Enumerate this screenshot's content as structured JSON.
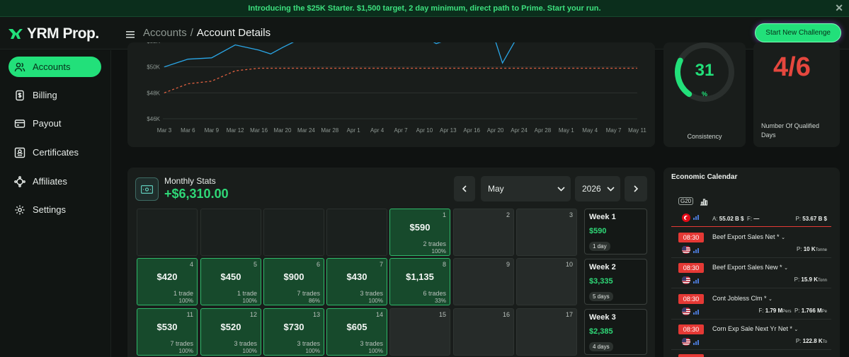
{
  "banner": {
    "text": "Introducing the $25K Starter. $1,500 target, 2 day minimum, direct path to Prime. Start your run."
  },
  "brand": {
    "name": "YRM Prop.",
    "accent": "#22e07a"
  },
  "breadcrumb": {
    "root": "Accounts",
    "separator": "/",
    "current": "Account Details"
  },
  "header": {
    "cta_label": "Start New Challenge"
  },
  "sidebar": {
    "items": [
      {
        "label": "Accounts",
        "icon": "users-icon",
        "active": true
      },
      {
        "label": "Billing",
        "icon": "billing-icon",
        "active": false
      },
      {
        "label": "Payout",
        "icon": "payout-icon",
        "active": false
      },
      {
        "label": "Certificates",
        "icon": "certificate-icon",
        "active": false
      },
      {
        "label": "Affiliates",
        "icon": "affiliates-icon",
        "active": false
      },
      {
        "label": "Settings",
        "icon": "gear-icon",
        "active": false
      }
    ]
  },
  "chart_data": {
    "type": "line",
    "yticks": [
      "$46K",
      "$48K",
      "$50K",
      "$52K"
    ],
    "ylim": [
      46000,
      52000
    ],
    "xticks": [
      "Mar 3",
      "Mar 6",
      "Mar 9",
      "Mar 12",
      "Mar 16",
      "Mar 20",
      "Mar 24",
      "Mar 28",
      "Apr 1",
      "Apr 4",
      "Apr 7",
      "Apr 10",
      "Apr 13",
      "Apr 16",
      "Apr 20",
      "Apr 24",
      "Apr 28",
      "May 1",
      "May 4",
      "May 7",
      "May 11"
    ],
    "grid": true,
    "series": [
      {
        "color": "#2aa7e8",
        "style": "solid",
        "points": [
          [
            0,
            50000
          ],
          [
            1,
            50600
          ],
          [
            2,
            50700
          ],
          [
            3,
            51700
          ],
          [
            4,
            51300
          ],
          [
            4.5,
            51000
          ],
          [
            5,
            51500
          ],
          [
            6,
            52400
          ],
          [
            7,
            52600
          ],
          [
            8,
            52500
          ],
          [
            9,
            52700
          ],
          [
            10,
            52500
          ],
          [
            11,
            52300
          ],
          [
            11.5,
            51800
          ],
          [
            12,
            52100
          ],
          [
            13,
            52600
          ],
          [
            14,
            52000
          ],
          [
            14.3,
            50300
          ],
          [
            14.8,
            51900
          ],
          [
            15,
            52200
          ],
          [
            16,
            52800
          ],
          [
            17,
            52400
          ],
          [
            17.5,
            52000
          ],
          [
            18,
            52600
          ],
          [
            19,
            52800
          ],
          [
            20,
            52700
          ]
        ]
      },
      {
        "color": "#e06040",
        "style": "dashed",
        "points": [
          [
            0,
            48000
          ],
          [
            1,
            48700
          ],
          [
            2,
            48900
          ],
          [
            3,
            49700
          ],
          [
            4,
            49900
          ],
          [
            5,
            49900
          ],
          [
            10,
            49900
          ],
          [
            20,
            49900
          ]
        ]
      }
    ]
  },
  "consistency": {
    "value": "31",
    "unit": "%",
    "label": "Consistency",
    "fraction": 0.31
  },
  "qualified_days": {
    "value": "4/6",
    "label": "Number Of Qualified Days"
  },
  "monthly": {
    "title": "Monthly Stats",
    "total": "+$6,310.00",
    "month": "May",
    "year": "2026",
    "weeks": [
      {
        "label": "Week 1",
        "amount": "$590",
        "days": "1 day"
      },
      {
        "label": "Week 2",
        "amount": "$3,335",
        "days": "5 days"
      },
      {
        "label": "Week 3",
        "amount": "$2,385",
        "days": "4 days"
      }
    ],
    "days": [
      {
        "num": "",
        "amount": "",
        "trades": "",
        "pct": "",
        "kind": "empty"
      },
      {
        "num": "",
        "amount": "",
        "trades": "",
        "pct": "",
        "kind": "empty"
      },
      {
        "num": "",
        "amount": "",
        "trades": "",
        "pct": "",
        "kind": "empty"
      },
      {
        "num": "",
        "amount": "",
        "trades": "",
        "pct": "",
        "kind": "empty"
      },
      {
        "num": "1",
        "amount": "$590",
        "trades": "2 trades",
        "pct": "100%",
        "kind": "profit"
      },
      {
        "num": "2",
        "amount": "",
        "trades": "",
        "pct": "",
        "kind": "future"
      },
      {
        "num": "3",
        "amount": "",
        "trades": "",
        "pct": "",
        "kind": "future"
      },
      {
        "num": "4",
        "amount": "$420",
        "trades": "1 trade",
        "pct": "100%",
        "kind": "profit"
      },
      {
        "num": "5",
        "amount": "$450",
        "trades": "1 trade",
        "pct": "100%",
        "kind": "profit"
      },
      {
        "num": "6",
        "amount": "$900",
        "trades": "7 trades",
        "pct": "86%",
        "kind": "profit"
      },
      {
        "num": "7",
        "amount": "$430",
        "trades": "3 trades",
        "pct": "100%",
        "kind": "profit"
      },
      {
        "num": "8",
        "amount": "$1,135",
        "trades": "6 trades",
        "pct": "33%",
        "kind": "profit"
      },
      {
        "num": "9",
        "amount": "",
        "trades": "",
        "pct": "",
        "kind": "future"
      },
      {
        "num": "10",
        "amount": "",
        "trades": "",
        "pct": "",
        "kind": "future"
      },
      {
        "num": "11",
        "amount": "$530",
        "trades": "7 trades",
        "pct": "100%",
        "kind": "profit"
      },
      {
        "num": "12",
        "amount": "$520",
        "trades": "3 trades",
        "pct": "100%",
        "kind": "profit"
      },
      {
        "num": "13",
        "amount": "$730",
        "trades": "3 trades",
        "pct": "100%",
        "kind": "profit"
      },
      {
        "num": "14",
        "amount": "$605",
        "trades": "3 trades",
        "pct": "100%",
        "kind": "profit"
      },
      {
        "num": "15",
        "amount": "",
        "trades": "",
        "pct": "",
        "kind": "future"
      },
      {
        "num": "16",
        "amount": "",
        "trades": "",
        "pct": "",
        "kind": "future"
      },
      {
        "num": "17",
        "amount": "",
        "trades": "",
        "pct": "",
        "kind": "future"
      }
    ]
  },
  "economic_calendar": {
    "title": "Economic Calendar",
    "top_row": {
      "a": "A:",
      "a_val": "55.02 B $",
      "f": "F:",
      "f_val": "—",
      "p": "P:",
      "p_val": "53.67 B $"
    },
    "rows": [
      {
        "time": "08:30",
        "name": "Beef Export Sales Net *",
        "values": [
          {
            "k": "P:",
            "v": "10 K",
            "u": "Tonne"
          }
        ]
      },
      {
        "time": "08:30",
        "name": "Beef Export Sales New *",
        "values": [
          {
            "k": "P:",
            "v": "15.9 K",
            "u": "Tonn"
          }
        ]
      },
      {
        "time": "08:30",
        "name": "Cont Jobless Clm *",
        "values": [
          {
            "k": "F:",
            "v": "1.79 M",
            "u": "Pers"
          },
          {
            "k": "P:",
            "v": "1.766 M",
            "u": "Pe"
          }
        ]
      },
      {
        "time": "08:30",
        "name": "Corn Exp Sale Next Yr Net *",
        "values": [
          {
            "k": "P:",
            "v": "122.8 K",
            "u": "To"
          }
        ]
      }
    ]
  }
}
